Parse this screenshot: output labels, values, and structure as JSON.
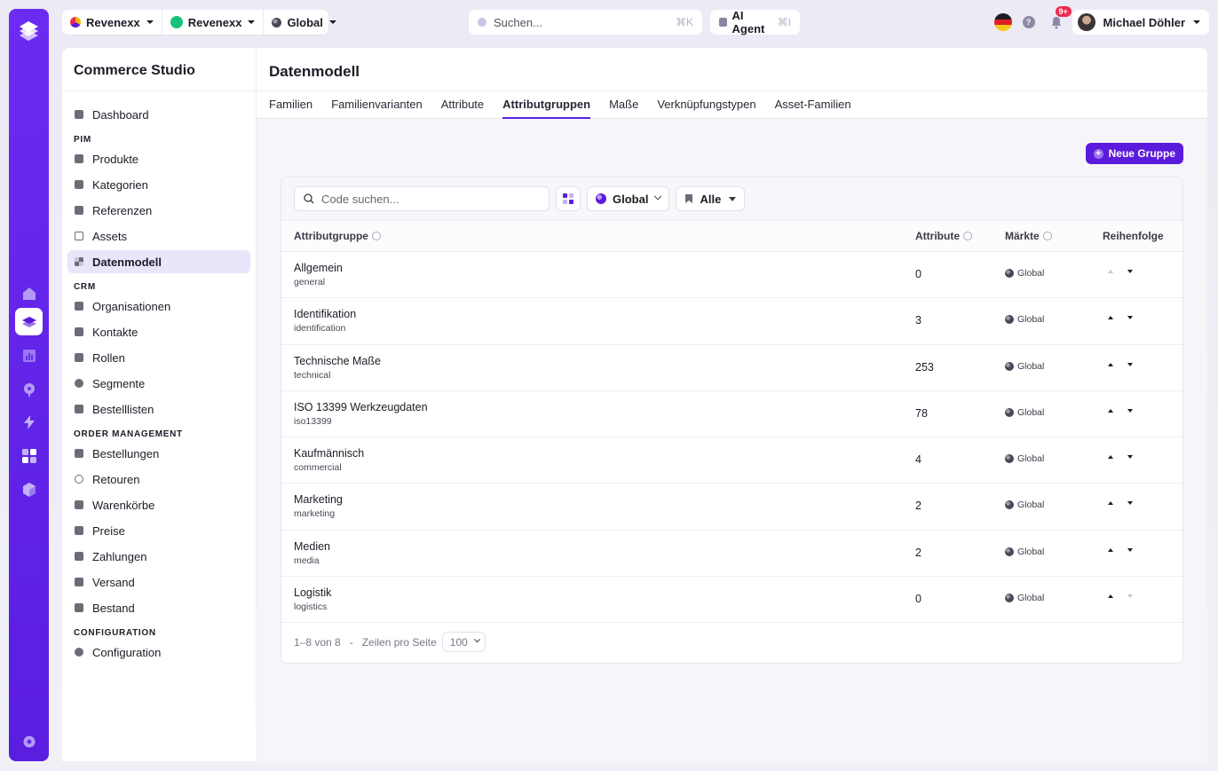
{
  "topbar": {
    "org_selector": "Revenexx",
    "store_selector": "Revenexx",
    "market_selector": "Global",
    "search_placeholder": "Suchen...",
    "search_shortcut": "⌘K",
    "ai_agent_label": "AI Agent",
    "ai_agent_shortcut": "⌘I",
    "help_label": "?",
    "notifications_badge": "9+",
    "user_name": "Michael Döhler"
  },
  "sidebar": {
    "brand": "Commerce Studio",
    "dashboard": "Dashboard",
    "sections": {
      "pim": "PIM",
      "crm": "CRM",
      "order_management": "ORDER MANAGEMENT",
      "configuration": "CONFIGURATION"
    },
    "pim_items": [
      "Produkte",
      "Kategorien",
      "Referenzen",
      "Assets",
      "Datenmodell"
    ],
    "crm_items": [
      "Organisationen",
      "Kontakte",
      "Rollen",
      "Segmente",
      "Bestelllisten"
    ],
    "order_items": [
      "Bestellungen",
      "Retouren",
      "Warenkörbe",
      "Preise",
      "Zahlungen",
      "Versand",
      "Bestand"
    ],
    "config_items": [
      "Configuration"
    ]
  },
  "main": {
    "title": "Datenmodell",
    "tabs": [
      "Familien",
      "Familienvarianten",
      "Attribute",
      "Attributgruppen",
      "Maße",
      "Verknüpfungstypen",
      "Asset-Familien"
    ],
    "active_tab": "Attributgruppen",
    "new_group_label": "Neue Gruppe",
    "filters": {
      "code_search_placeholder": "Code suchen...",
      "market": "Global",
      "scope": "Alle"
    },
    "table": {
      "headers": {
        "name": "Attributgruppe",
        "attributes": "Attribute",
        "markets": "Märkte",
        "order": "Reihenfolge"
      },
      "rows": [
        {
          "label": "Allgemein",
          "code": "general",
          "attributes": "0",
          "market": "Global"
        },
        {
          "label": "Identifikation",
          "code": "identification",
          "attributes": "3",
          "market": "Global"
        },
        {
          "label": "Technische Maße",
          "code": "technical",
          "attributes": "253",
          "market": "Global"
        },
        {
          "label": "ISO 13399 Werkzeugdaten",
          "code": "iso13399",
          "attributes": "78",
          "market": "Global"
        },
        {
          "label": "Kaufmännisch",
          "code": "commercial",
          "attributes": "4",
          "market": "Global"
        },
        {
          "label": "Marketing",
          "code": "marketing",
          "attributes": "2",
          "market": "Global"
        },
        {
          "label": "Medien",
          "code": "media",
          "attributes": "2",
          "market": "Global"
        },
        {
          "label": "Logistik",
          "code": "logistics",
          "attributes": "0",
          "market": "Global"
        }
      ]
    },
    "pagination": {
      "range": "1–8 von 8",
      "separator": "-",
      "rows_per_page_label": "Zeilen pro Seite",
      "rows_per_page": "100"
    }
  },
  "colors": {
    "brand_purple": "#5b1bdc",
    "active_nav_bg": "#ebe5fb",
    "badge_red": "#ee2c50"
  }
}
